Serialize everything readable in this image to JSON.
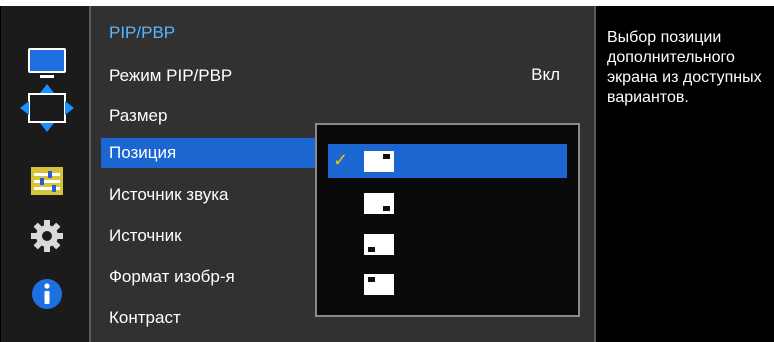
{
  "menu": {
    "title": "PIP/PBP",
    "items": [
      {
        "label": "Режим PIP/PBP",
        "value": "Вкл"
      },
      {
        "label": "Размер"
      },
      {
        "label": "Позиция"
      },
      {
        "label": "Источник звука"
      },
      {
        "label": "Источник"
      },
      {
        "label": "Формат изобр-я"
      },
      {
        "label": "Контраст"
      }
    ],
    "active_index": 2
  },
  "rail": {
    "icons": [
      "monitor-icon",
      "position-arrows-icon",
      "sliders-icon",
      "gear-icon",
      "info-icon"
    ],
    "selected": "position-arrows-icon"
  },
  "position_options": {
    "items": [
      "top-right",
      "bottom-right",
      "bottom-left",
      "top-left"
    ],
    "selected_index": 0,
    "check_mark": "✓"
  },
  "help": {
    "text": "Выбор позиции дополнительного экрана из доступных вариантов."
  },
  "colors": {
    "accent": "#1b66d1",
    "title": "#5ab4ff",
    "check": "#f2c200"
  }
}
